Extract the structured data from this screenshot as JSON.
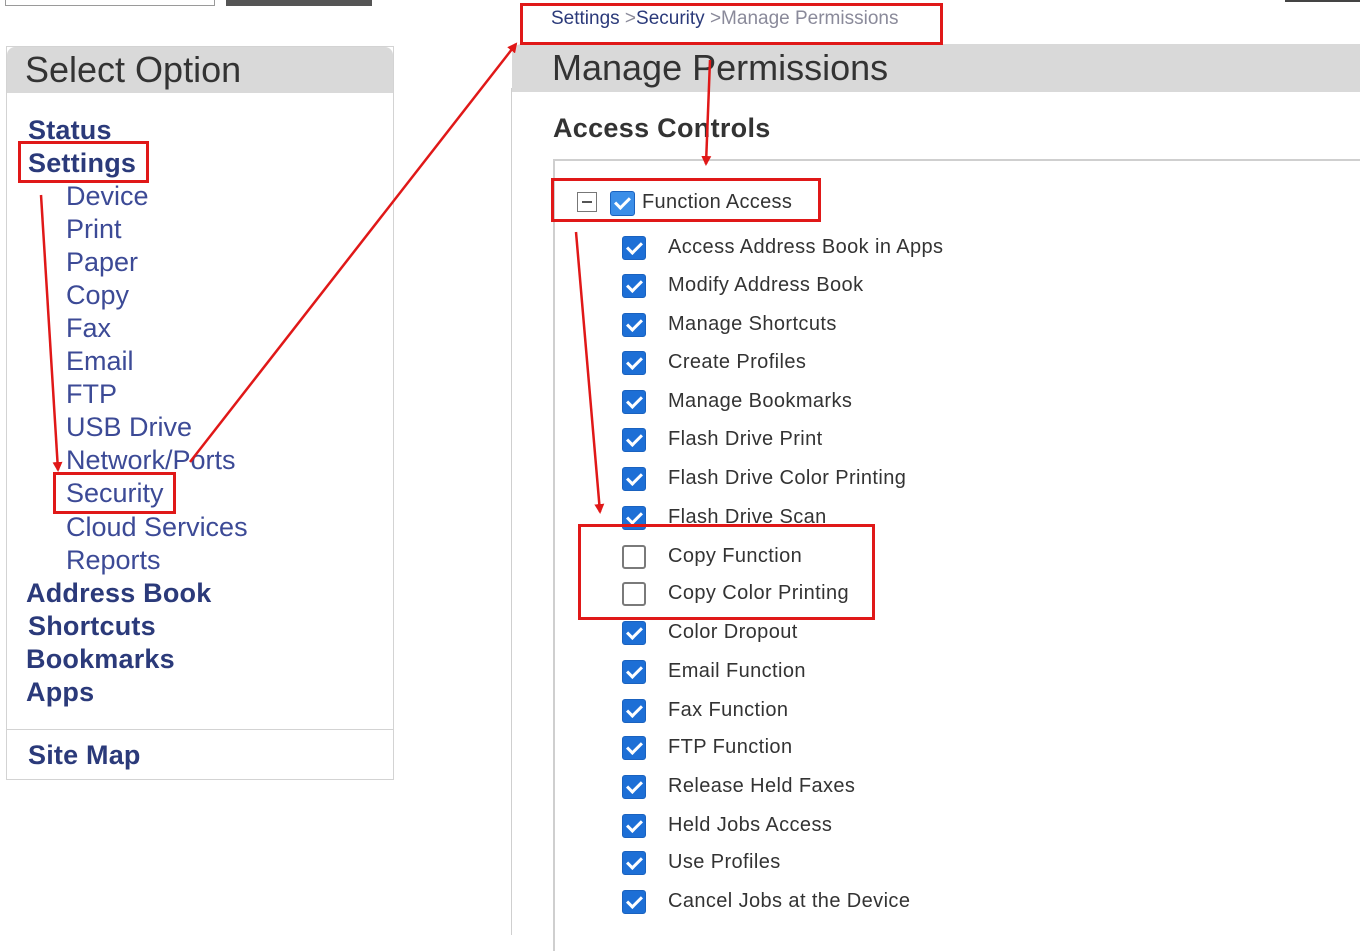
{
  "sidebar": {
    "title": "Select Option",
    "nav": {
      "status": "Status",
      "settings": "Settings",
      "settings_children": [
        "Device",
        "Print",
        "Paper",
        "Copy",
        "Fax",
        "Email",
        "FTP",
        "USB Drive",
        "Network/Ports",
        "Security",
        "Cloud Services",
        "Reports"
      ],
      "address_book": "Address Book",
      "shortcuts": "Shortcuts",
      "bookmarks": "Bookmarks",
      "apps": "Apps"
    },
    "site_map": "Site Map"
  },
  "breadcrumb": {
    "settings": "Settings",
    "separator1": " >",
    "security": "Security",
    "separator2": " >",
    "current": "Manage Permissions"
  },
  "main": {
    "title": "Manage Permissions",
    "section_title": "Access Controls",
    "group": {
      "label": "Function Access",
      "checked": true,
      "collapse_icon": "minus-box-icon"
    },
    "permissions": [
      {
        "label": "Access Address Book in Apps",
        "checked": true
      },
      {
        "label": "Modify Address Book",
        "checked": true
      },
      {
        "label": "Manage Shortcuts",
        "checked": true
      },
      {
        "label": "Create Profiles",
        "checked": true
      },
      {
        "label": "Manage Bookmarks",
        "checked": true
      },
      {
        "label": "Flash Drive Print",
        "checked": true
      },
      {
        "label": "Flash Drive Color Printing",
        "checked": true
      },
      {
        "label": "Flash Drive Scan",
        "checked": true
      },
      {
        "label": "Copy Function",
        "checked": false
      },
      {
        "label": "Copy Color Printing",
        "checked": false
      },
      {
        "label": "Color Dropout",
        "checked": true
      },
      {
        "label": "Email Function",
        "checked": true
      },
      {
        "label": "Fax Function",
        "checked": true
      },
      {
        "label": "FTP Function",
        "checked": true
      },
      {
        "label": "Release Held Faxes",
        "checked": true
      },
      {
        "label": "Held Jobs Access",
        "checked": true
      },
      {
        "label": "Use Profiles",
        "checked": true
      },
      {
        "label": "Cancel Jobs at the Device",
        "checked": true
      }
    ]
  },
  "colors": {
    "nav_link": "#2b3a7a",
    "checkbox_checked": "#1d6fd6",
    "annotation_red": "#e01818",
    "header_gray": "#d9d9d9"
  }
}
